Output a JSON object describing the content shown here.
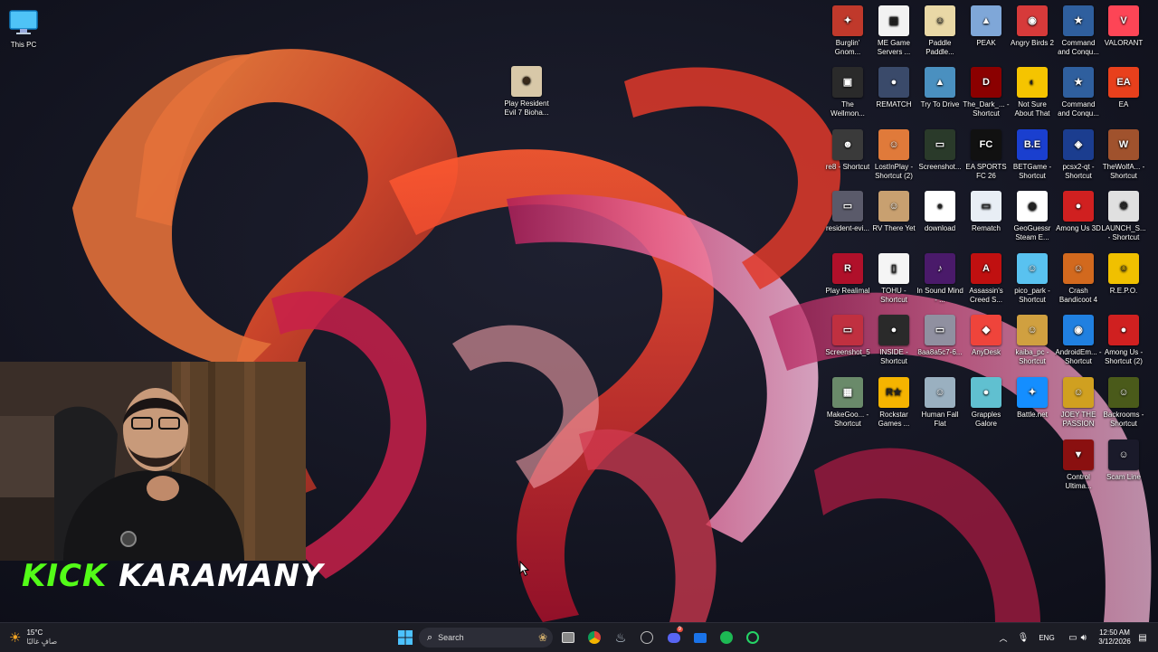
{
  "desktop": {
    "this_pc_label": "This PC",
    "resident_evil_label": "Play Resident Evil 7 Bioha...",
    "icons": [
      {
        "label": "Burglin' Gnom...",
        "bg": "#c0392b",
        "glyph": "✦"
      },
      {
        "label": "ME Game Servers ...",
        "bg": "#f2f2f2",
        "glyph": "▦"
      },
      {
        "label": "Paddle Paddle...",
        "bg": "#e9d8a6",
        "glyph": "☺"
      },
      {
        "label": "PEAK",
        "bg": "#7fa7d8",
        "glyph": "▲"
      },
      {
        "label": "Angry Birds 2",
        "bg": "#d63a3a",
        "glyph": "◉"
      },
      {
        "label": "Command and Conqu...",
        "bg": "#2f5f9e",
        "glyph": "★"
      },
      {
        "label": "VALORANT",
        "bg": "#fd4556",
        "glyph": "V"
      },
      {
        "label": "The Wellmon...",
        "bg": "#2a2a2a",
        "glyph": "▣"
      },
      {
        "label": "REMATCH",
        "bg": "#3a4a6a",
        "glyph": "●"
      },
      {
        "label": "Try To Drive",
        "bg": "#4a90c0",
        "glyph": "▲"
      },
      {
        "label": "The_Dark_... - Shortcut",
        "bg": "#8b0000",
        "glyph": "D"
      },
      {
        "label": "Not Sure About That",
        "bg": "#f5c400",
        "glyph": "◐"
      },
      {
        "label": "Command and Conqu...",
        "bg": "#2f5f9e",
        "glyph": "★"
      },
      {
        "label": "EA",
        "bg": "#e8401c",
        "glyph": "EA"
      },
      {
        "label": "re8 - Shortcut",
        "bg": "#3a3a3a",
        "glyph": "☻"
      },
      {
        "label": "LostInPlay - Shortcut (2)",
        "bg": "#e07a3a",
        "glyph": "☺"
      },
      {
        "label": "Screenshot...",
        "bg": "#2a3a2a",
        "glyph": "▭"
      },
      {
        "label": "EA SPORTS FC 26",
        "bg": "#111111",
        "glyph": "FC"
      },
      {
        "label": "BETGame - Shortcut",
        "bg": "#1a3fcf",
        "glyph": "B.E"
      },
      {
        "label": "pcsx2-qt - Shortcut",
        "bg": "#1b3d8f",
        "glyph": "◈"
      },
      {
        "label": "TheWolfA... - Shortcut",
        "bg": "#a0522d",
        "glyph": "W"
      },
      {
        "label": "resident-evi...",
        "bg": "#5a5a6a",
        "glyph": "▭"
      },
      {
        "label": "RV There Yet",
        "bg": "#c8a070",
        "glyph": "☺"
      },
      {
        "label": "download",
        "bg": "#ffffff",
        "glyph": "●"
      },
      {
        "label": "Rematch",
        "bg": "#e8eef5",
        "glyph": "▭"
      },
      {
        "label": "GeoGuessr Steam E...",
        "bg": "#ffffff",
        "glyph": "◉"
      },
      {
        "label": "Among Us 3D",
        "bg": "#d02020",
        "glyph": "●"
      },
      {
        "label": "LAUNCH_S... - Shortcut",
        "bg": "#e0e0e0",
        "glyph": "⚙"
      },
      {
        "label": "Play Realimal",
        "bg": "#b0102a",
        "glyph": "R"
      },
      {
        "label": "TOHU - Shortcut",
        "bg": "#f5f5f5",
        "glyph": "▯"
      },
      {
        "label": "In Sound Mind - ...",
        "bg": "#4a1a6a",
        "glyph": "♪"
      },
      {
        "label": "Assassin's Creed S...",
        "bg": "#c01010",
        "glyph": "A"
      },
      {
        "label": "pico_park - Shortcut",
        "bg": "#59c2f0",
        "glyph": "☺"
      },
      {
        "label": "Crash Bandicoot 4",
        "bg": "#d2691e",
        "glyph": "☺"
      },
      {
        "label": "R.E.P.O.",
        "bg": "#f0c000",
        "glyph": "☺"
      },
      {
        "label": "Screenshot_5",
        "bg": "#c03040",
        "glyph": "▭"
      },
      {
        "label": "INSIDE - Shortcut",
        "bg": "#2a2a2a",
        "glyph": "●"
      },
      {
        "label": "8aa8a5c7-6...",
        "bg": "#9090a0",
        "glyph": "▭"
      },
      {
        "label": "AnyDesk",
        "bg": "#ef443b",
        "glyph": "◆"
      },
      {
        "label": "kaiba_pc - Shortcut",
        "bg": "#d0a040",
        "glyph": "☺"
      },
      {
        "label": "AndroidEm... - Shortcut",
        "bg": "#2080e0",
        "glyph": "◉"
      },
      {
        "label": "Among Us - Shortcut (2)",
        "bg": "#d02020",
        "glyph": "●"
      },
      {
        "label": "MakeGoo... - Shortcut",
        "bg": "#6a8a6a",
        "glyph": "▦"
      },
      {
        "label": "Rockstar Games ...",
        "bg": "#f5b400",
        "glyph": "R★"
      },
      {
        "label": "Human Fall Flat",
        "bg": "#9ab0c0",
        "glyph": "☺"
      },
      {
        "label": "Grapples Galore",
        "bg": "#60c0d0",
        "glyph": "●"
      },
      {
        "label": "Battle.net",
        "bg": "#148eff",
        "glyph": "✦"
      },
      {
        "label": "JOEY THE PASSION",
        "bg": "#d0a020",
        "glyph": "☺"
      },
      {
        "label": "Backrooms - Shortcut",
        "bg": "#4a5a1a",
        "glyph": "☺"
      },
      {
        "label": "Control Ultima...",
        "bg": "#8a1010",
        "glyph": "▼"
      },
      {
        "label": "Scam Line",
        "bg": "#1a1a2a",
        "glyph": "☺"
      }
    ]
  },
  "overlay": {
    "kick_word": "KICK",
    "streamer_name": "KARAMANY"
  },
  "taskbar": {
    "weather_temp": "15°C",
    "weather_desc": "صافٍ غالبًا",
    "search_placeholder": "Search",
    "language": "ENG",
    "time": "12:50 AM",
    "date": "3/12/2026",
    "discord_badge": "9"
  }
}
